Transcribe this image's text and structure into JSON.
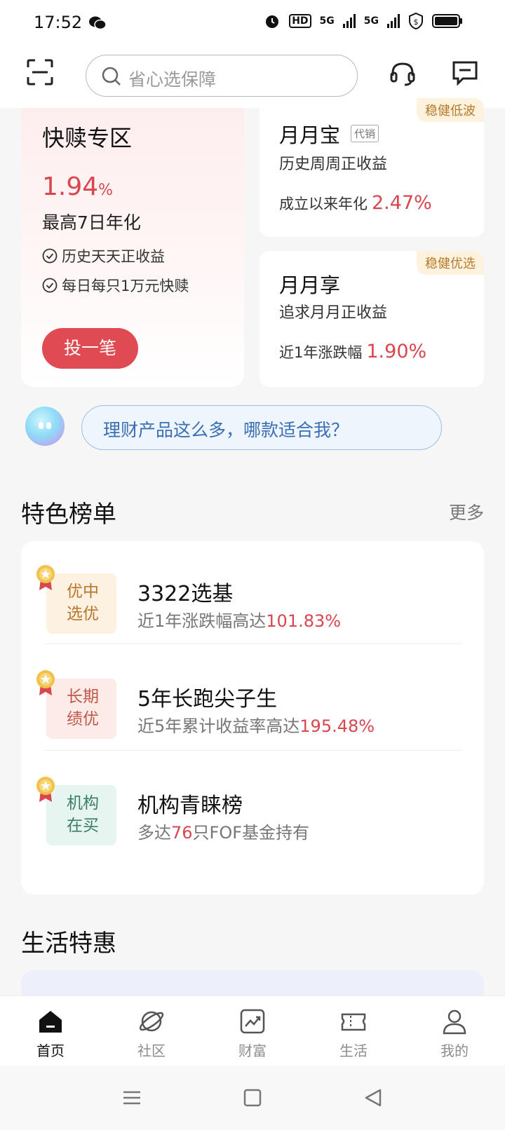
{
  "status_bar": {
    "time": "17:52",
    "hd": "HD",
    "net1": "5G",
    "net2": "5G"
  },
  "header": {
    "search_placeholder": "省心选保障"
  },
  "kuaishu": {
    "title": "快赎专区",
    "rate": "1.94",
    "rate_unit": "%",
    "rate_desc": "最高7日年化",
    "checks": [
      "历史天天正收益",
      "每日每只1万元快赎"
    ],
    "button": "投一笔"
  },
  "yueyuebao": {
    "badge": "稳健低波",
    "title": "月月宝",
    "tag": "代销",
    "sub": "历史周周正收益",
    "rate_label": "成立以来年化",
    "rate_value": "2.47%"
  },
  "yueyuexiang": {
    "badge": "稳健优选",
    "title": "月月享",
    "sub": "追求月月正收益",
    "rate_label": "近1年涨跌幅",
    "rate_value": "1.90%"
  },
  "assistant": {
    "prompt": "理财产品这么多，哪款适合我？"
  },
  "ranking": {
    "title": "特色榜单",
    "more": "更多",
    "items": [
      {
        "badge_line1": "优中",
        "badge_line2": "选优",
        "title": "3322选基",
        "sub_prefix": "近1年涨跌幅高达",
        "sub_value": "101.83%",
        "sub_suffix": "",
        "badge_bg": "#fdf1e2",
        "badge_color": "#b8762a"
      },
      {
        "badge_line1": "长期",
        "badge_line2": "绩优",
        "title": "5年长跑尖子生",
        "sub_prefix": "近5年累计收益率高达",
        "sub_value": "195.48%",
        "sub_suffix": "",
        "badge_bg": "#fdebe8",
        "badge_color": "#c0584a"
      },
      {
        "badge_line1": "机构",
        "badge_line2": "在买",
        "title": "机构青睐榜",
        "sub_prefix": "多达",
        "sub_value": "76",
        "sub_suffix": "只FOF基金持有",
        "badge_bg": "#e6f5ef",
        "badge_color": "#3b7d66"
      }
    ]
  },
  "life": {
    "title": "生活特惠"
  },
  "bottom_nav": {
    "items": [
      {
        "label": "首页",
        "icon": "home-icon"
      },
      {
        "label": "社区",
        "icon": "planet-icon"
      },
      {
        "label": "财富",
        "icon": "chart-icon"
      },
      {
        "label": "生活",
        "icon": "ticket-icon"
      },
      {
        "label": "我的",
        "icon": "user-icon"
      }
    ]
  }
}
